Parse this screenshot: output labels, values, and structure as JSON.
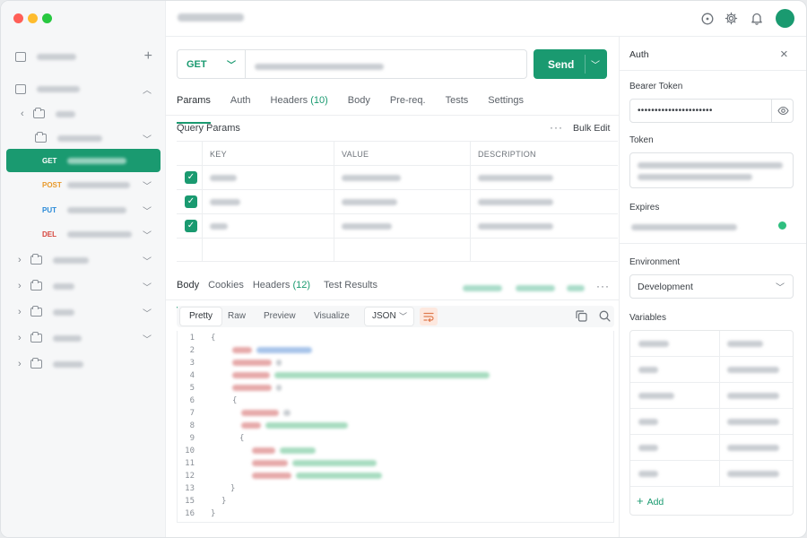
{
  "window": {
    "traffic_lights": [
      "#ff5f57",
      "#febc2e",
      "#28c840"
    ],
    "avatar_color": "#1a9a70",
    "top_icons": [
      "compass-icon",
      "gear-icon",
      "bell-icon"
    ]
  },
  "colors": {
    "accent": "#1a9a70",
    "get": "#ffffff",
    "post": "#e89a2c",
    "put": "#2a8ad8",
    "del": "#d6453d"
  },
  "sidebar": {
    "requests": [
      {
        "method": "GET",
        "active": true
      },
      {
        "method": "POST",
        "active": false
      },
      {
        "method": "PUT",
        "active": false
      },
      {
        "method": "DEL",
        "active": false
      }
    ]
  },
  "request": {
    "method": "GET",
    "send_label": "Send",
    "tabs": [
      {
        "label": "Params",
        "count": ""
      },
      {
        "label": "Auth",
        "count": ""
      },
      {
        "label": "Headers",
        "count": "(10)"
      },
      {
        "label": "Body",
        "count": ""
      },
      {
        "label": "Pre-req.",
        "count": ""
      },
      {
        "label": "Tests",
        "count": ""
      },
      {
        "label": "Settings",
        "count": ""
      }
    ],
    "query_params_title": "Query Params",
    "bulk_edit": "Bulk Edit",
    "columns": [
      "KEY",
      "VALUE",
      "DESCRIPTION"
    ]
  },
  "response": {
    "tabs": [
      {
        "label": "Body",
        "count": ""
      },
      {
        "label": "Cookies",
        "count": ""
      },
      {
        "label": "Headers",
        "count": "(12)"
      },
      {
        "label": "Test Results",
        "count": ""
      }
    ],
    "view_modes": [
      "Pretty",
      "Raw",
      "Preview",
      "Visualize"
    ],
    "format": "JSON",
    "line_numbers": [
      "1",
      "2",
      "3",
      "4",
      "5",
      "6",
      "7",
      "8",
      "9",
      "10",
      "11",
      "12",
      "13",
      "15",
      "16"
    ]
  },
  "auth_panel": {
    "title": "Auth",
    "bearer_label": "Bearer Token",
    "bearer_value": "••••••••••••••••••••••",
    "token_label": "Token",
    "expires_label": "Expires",
    "environment_label": "Environment",
    "environment_value": "Development",
    "variables_label": "Variables",
    "add_label": "Add"
  }
}
